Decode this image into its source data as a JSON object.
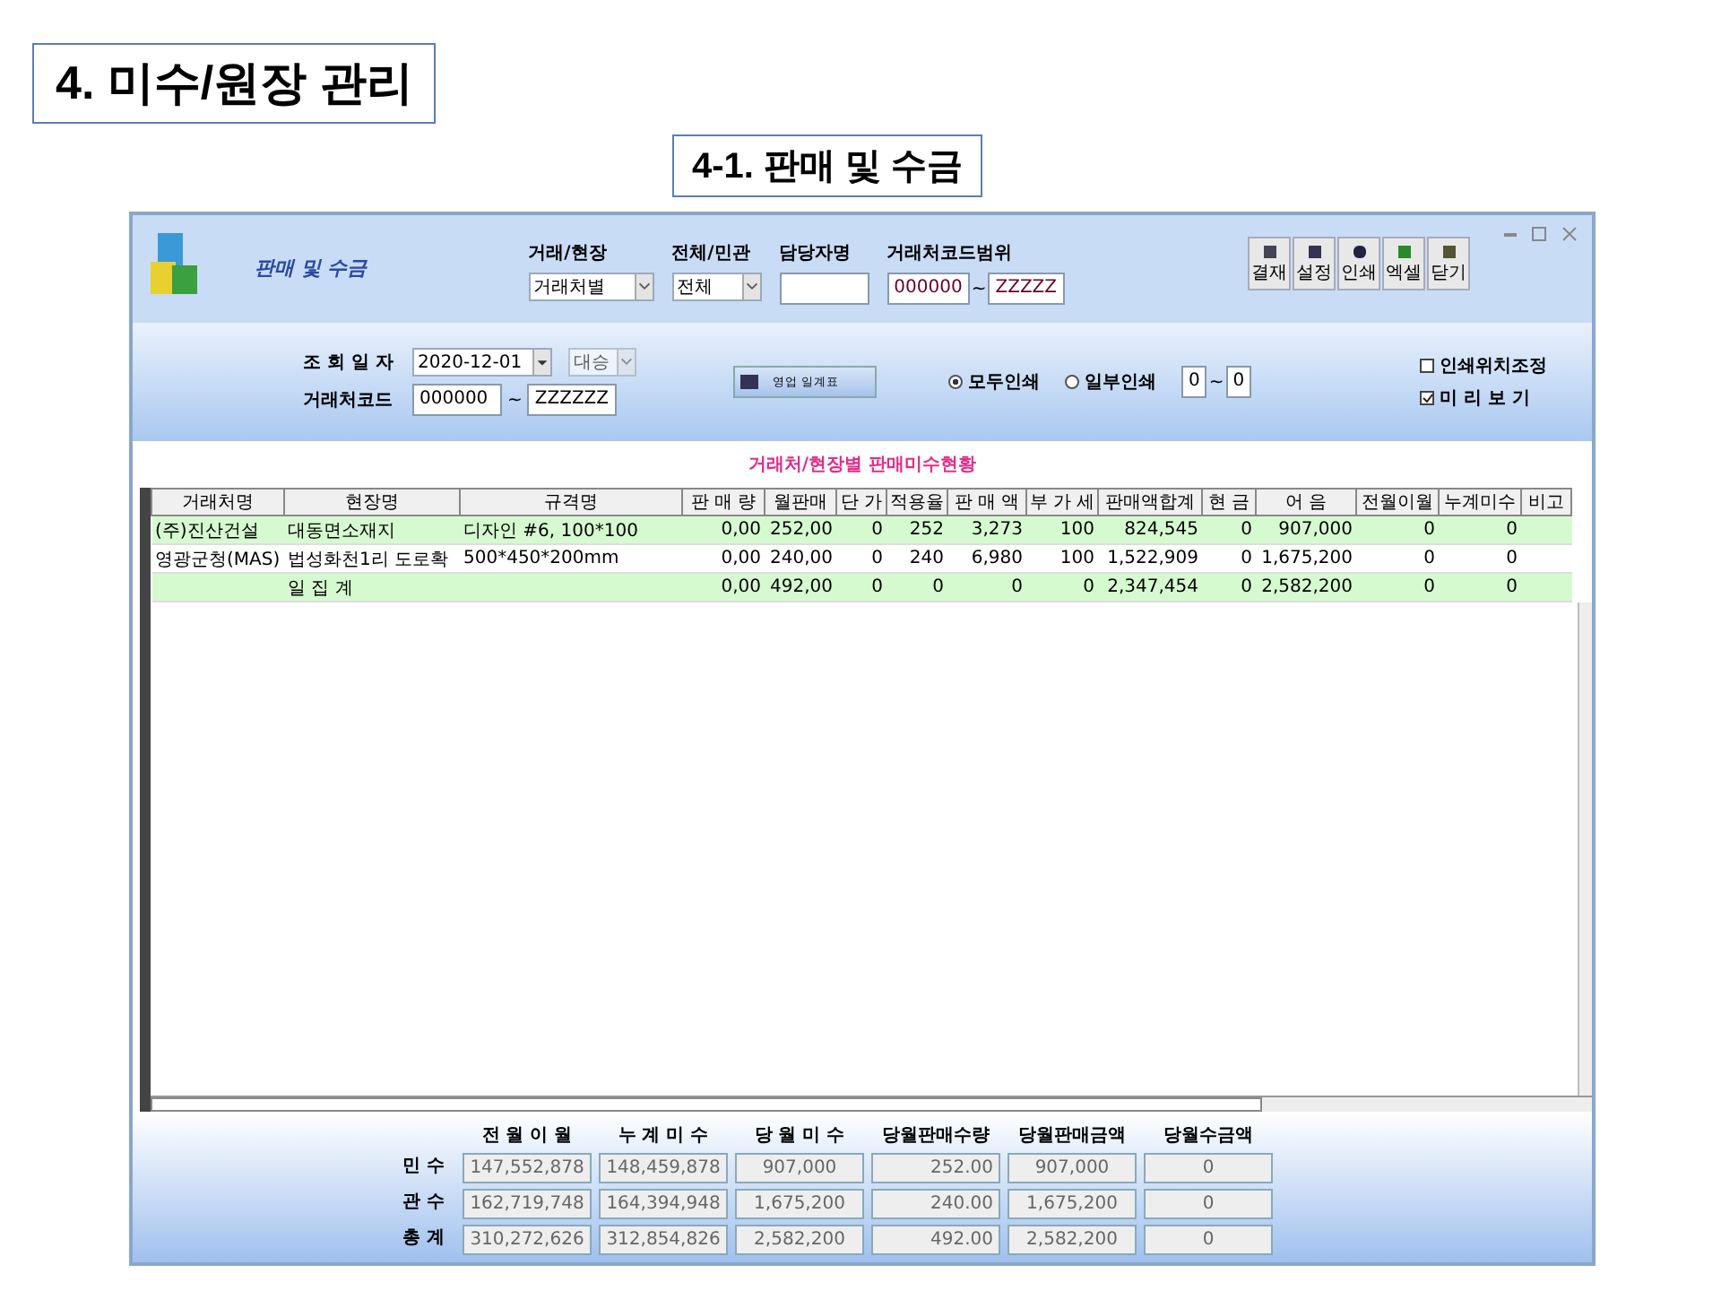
{
  "slide": {
    "title": "4. 미수/원장 관리",
    "subtitle": "4-1. 판매 및 수금"
  },
  "window": {
    "title": "판매 및 수금"
  },
  "filters": [
    {
      "label": "거래/현장",
      "kind": "select",
      "value": "거래처별"
    },
    {
      "label": "전체/민관",
      "kind": "select",
      "value": "전체"
    },
    {
      "label": "담당자명",
      "kind": "input"
    },
    {
      "label": "거래처코드범위",
      "kind": "range",
      "from": "000000",
      "sep": "~",
      "to": "ZZZZZ"
    }
  ],
  "toolbar": [
    {
      "label": "결재"
    },
    {
      "label": "설정"
    },
    {
      "label": "인쇄"
    },
    {
      "label": "엑셀"
    },
    {
      "label": "닫기"
    }
  ],
  "query": {
    "date_label": "조 회 일 자",
    "date": "2020-12-01",
    "branch": {
      "value": "대승",
      "disabled": true
    },
    "code_label": "거래처코드",
    "code_from": "000000",
    "code_sep": "~",
    "code_to": "ZZZZZZ",
    "report_button": "영업 일계표",
    "print_modes": [
      {
        "label": "모두인쇄",
        "selected": true
      },
      {
        "label": "일부인쇄",
        "selected": false
      }
    ],
    "page_from": "0",
    "page_sep": "~",
    "page_to": "0",
    "options": [
      {
        "label": "인쇄위치조정",
        "checked": false
      },
      {
        "label": "미 리 보 기",
        "checked": true
      }
    ]
  },
  "table": {
    "title": "거래처/현장별 판매미수현황",
    "columns": [
      "거래처명",
      "현장명",
      "규격명",
      "판 매 량",
      "월판매",
      "단 가",
      "적용율",
      "판 매 액",
      "부 가 세",
      "판매액합계",
      "현 금",
      "어 음",
      "전월이월",
      "누계미수",
      "비고"
    ],
    "rows": [
      {
        "highlighted": true,
        "cells": [
          "(주)진산건설",
          "대동면소재지",
          "디자인 #6, 100*100",
          "0,00",
          "252,00",
          "0",
          "252",
          "3,273",
          "100",
          "824,545",
          "0",
          "907,000",
          "0",
          "0",
          ""
        ]
      },
      {
        "highlighted": false,
        "cells": [
          "영광군청(MAS)",
          "법성화천1리 도로확",
          "500*450*200mm",
          "0,00",
          "240,00",
          "0",
          "240",
          "6,980",
          "100",
          "1,522,909",
          "0",
          "1,675,200",
          "0",
          "0",
          ""
        ]
      },
      {
        "highlighted": true,
        "cells": [
          "",
          "일 집 계",
          "",
          "0,00",
          "492,00",
          "0",
          "0",
          "0",
          "0",
          "2,347,454",
          "0",
          "2,582,200",
          "0",
          "0",
          ""
        ]
      }
    ]
  },
  "summary": {
    "columns": [
      "전 월 이 월",
      "누 계 미 수",
      "당 월 미 수",
      "당월판매수량",
      "당월판매금액",
      "당월수금액"
    ],
    "rows": [
      {
        "label": "민 수",
        "values": [
          "147,552,878",
          "148,459,878",
          "907,000",
          "252.00",
          "907,000",
          "0"
        ]
      },
      {
        "label": "관 수",
        "values": [
          "162,719,748",
          "164,394,948",
          "1,675,200",
          "240.00",
          "1,675,200",
          "0"
        ]
      },
      {
        "label": "총 계",
        "values": [
          "310,272,626",
          "312,854,826",
          "2,582,200",
          "492.00",
          "2,582,200",
          "0"
        ]
      }
    ]
  }
}
